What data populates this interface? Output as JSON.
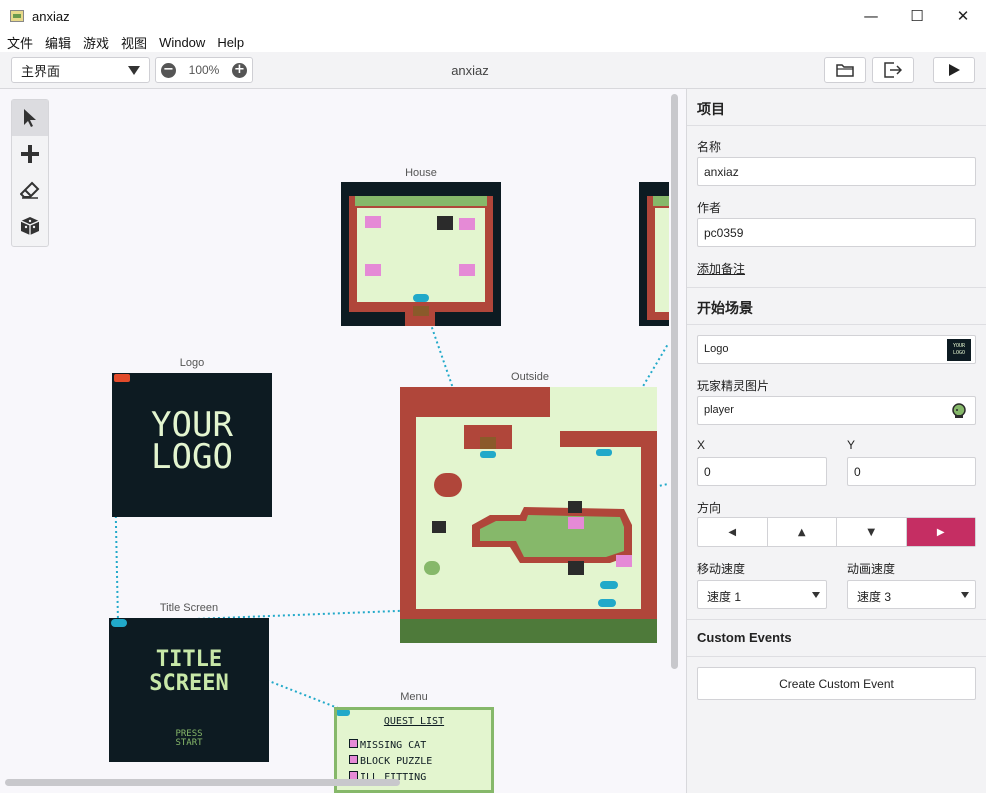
{
  "window": {
    "title": "anxiaz",
    "minimize": "—",
    "maximize": "☐",
    "close": "✕"
  },
  "menu": [
    "文件",
    "编辑",
    "游戏",
    "视图",
    "Window",
    "Help"
  ],
  "toolbar": {
    "scene_select": "主界面",
    "zoom": "100%",
    "zoom_out": "−",
    "zoom_in": "+",
    "project_name": "anxiaz"
  },
  "tools": [
    {
      "name": "select-tool",
      "icon": "cursor-icon",
      "active": true
    },
    {
      "name": "add-tool",
      "icon": "plus-icon",
      "active": false
    },
    {
      "name": "eraser-tool",
      "icon": "eraser-icon",
      "active": false
    },
    {
      "name": "color-tool",
      "icon": "cube-icon",
      "active": false
    }
  ],
  "scenes": {
    "house": {
      "label": "House"
    },
    "logo": {
      "label": "Logo",
      "text_line1": "YOUR",
      "text_line2": "LOGO"
    },
    "title_screen": {
      "label": "Title Screen",
      "text_line1": "TITLE",
      "text_line2": "SCREEN",
      "text_line3": "PRESS",
      "text_line4": "START"
    },
    "outside": {
      "label": "Outside"
    },
    "menu": {
      "label": "Menu",
      "heading": "QUEST LIST",
      "items": [
        "MISSING CAT",
        "BLOCK PUZZLE",
        "ILL FITTING"
      ]
    }
  },
  "sidebar": {
    "project_heading": "项目",
    "name_label": "名称",
    "name_value": "anxiaz",
    "author_label": "作者",
    "author_value": "pc0359",
    "add_notes": "添加备注",
    "start_heading": "开始场景",
    "start_scene": "Logo",
    "start_scene_thumb1": "YOUR",
    "start_scene_thumb2": "LOGO",
    "sprite_label": "玩家精灵图片",
    "sprite_value": "player",
    "x_label": "X",
    "x_value": "0",
    "y_label": "Y",
    "y_value": "0",
    "direction_label": "方向",
    "directions": [
      "◀",
      "▲",
      "▼",
      "▶"
    ],
    "active_direction": "right",
    "move_speed_label": "移动速度",
    "move_speed_value": "速度 1",
    "anim_speed_label": "动画速度",
    "anim_speed_value": "速度 3",
    "custom_events_heading": "Custom Events",
    "create_event": "Create Custom Event"
  },
  "colors": {
    "accent": "#c52e63",
    "connection": "#21a9c9",
    "gb_dark": "#0d1b22",
    "gb_light": "#e3f5cf",
    "gb_brick": "#b0463a",
    "gb_green": "#86b86a"
  }
}
